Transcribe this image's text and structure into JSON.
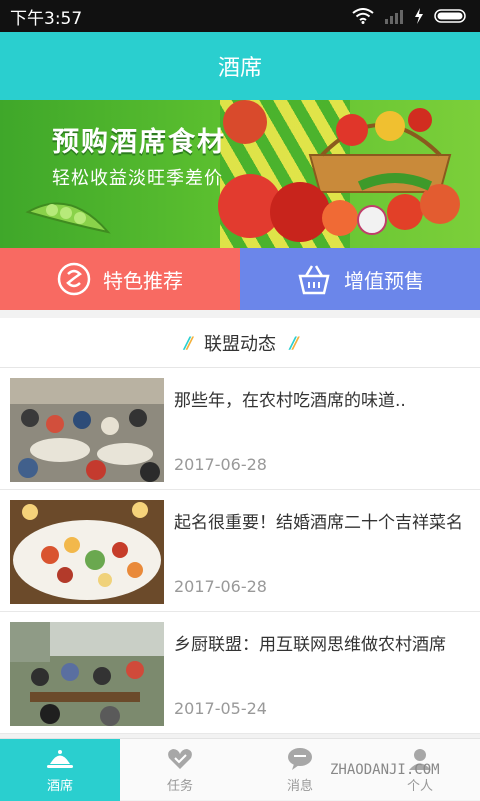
{
  "status_bar": {
    "time": "下午3:57"
  },
  "header": {
    "title": "酒席"
  },
  "banner": {
    "title": "预购酒席食材",
    "subtitle": "轻松收益淡旺季差价"
  },
  "categories": [
    {
      "label": "特色推荐",
      "icon": "recommend-icon",
      "color": "#f86a62"
    },
    {
      "label": "增值预售",
      "icon": "basket-icon",
      "color": "#6b86ea"
    }
  ],
  "section": {
    "title": "联盟动态"
  },
  "news": [
    {
      "title": "那些年，在农村吃酒席的味道..",
      "date": "2017-06-28"
    },
    {
      "title": "起名很重要！结婚酒席二十个吉祥菜名",
      "date": "2017-06-28"
    },
    {
      "title": "乡厨联盟：用互联网思维做农村酒席",
      "date": "2017-05-24"
    }
  ],
  "tabs": [
    {
      "label": "酒席",
      "icon": "dome-icon",
      "active": true
    },
    {
      "label": "任务",
      "icon": "heart-check-icon",
      "active": false
    },
    {
      "label": "消息",
      "icon": "chat-icon",
      "active": false
    },
    {
      "label": "个人",
      "icon": "user-icon",
      "active": false
    }
  ],
  "watermark": "ZHAODANJI.COM",
  "colors": {
    "header": "#2acfcf",
    "recommend": "#f86a62",
    "presale": "#6b86ea"
  }
}
